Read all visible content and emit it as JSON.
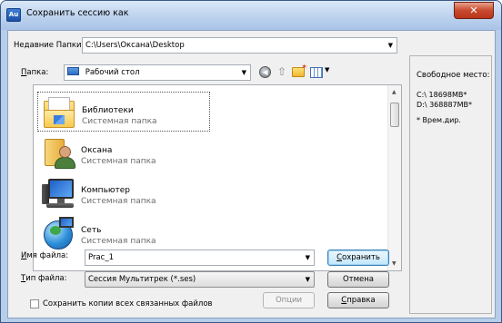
{
  "window": {
    "app_icon_text": "Au",
    "title": "Сохранить сессию как",
    "close_glyph": "✕"
  },
  "recent": {
    "label": "Недавние Папки:",
    "value": "C:\\Users\\Оксана\\Desktop"
  },
  "folder": {
    "label": "Папка:",
    "value": "Рабочий стол"
  },
  "toolbar_icons": [
    "back-icon",
    "up-folder-icon",
    "new-folder-icon",
    "view-menu-icon"
  ],
  "items": [
    {
      "name": "Библиотеки",
      "sub": "Системная папка",
      "icon": "libraries-icon"
    },
    {
      "name": "Оксана",
      "sub": "Системная папка",
      "icon": "user-folder-icon"
    },
    {
      "name": "Компьютер",
      "sub": "Системная папка",
      "icon": "computer-icon"
    },
    {
      "name": "Сеть",
      "sub": "Системная папка",
      "icon": "network-icon"
    }
  ],
  "free_space": {
    "header": "Свободное место:",
    "lines": [
      "C:\\  18698MB*",
      "D:\\  368887MB*"
    ],
    "note": "* Врем.дир."
  },
  "filename": {
    "label": "Имя файла:",
    "value": "Prac_1"
  },
  "filetype": {
    "label": "Тип файла:",
    "value": "Сессия Мультитрек (*.ses)"
  },
  "buttons": {
    "save": "Сохранить",
    "cancel": "Отмена",
    "options": "Опции",
    "help": "Справка"
  },
  "checkbox": {
    "label": "Сохранить копии всех связанных файлов",
    "checked": false
  }
}
